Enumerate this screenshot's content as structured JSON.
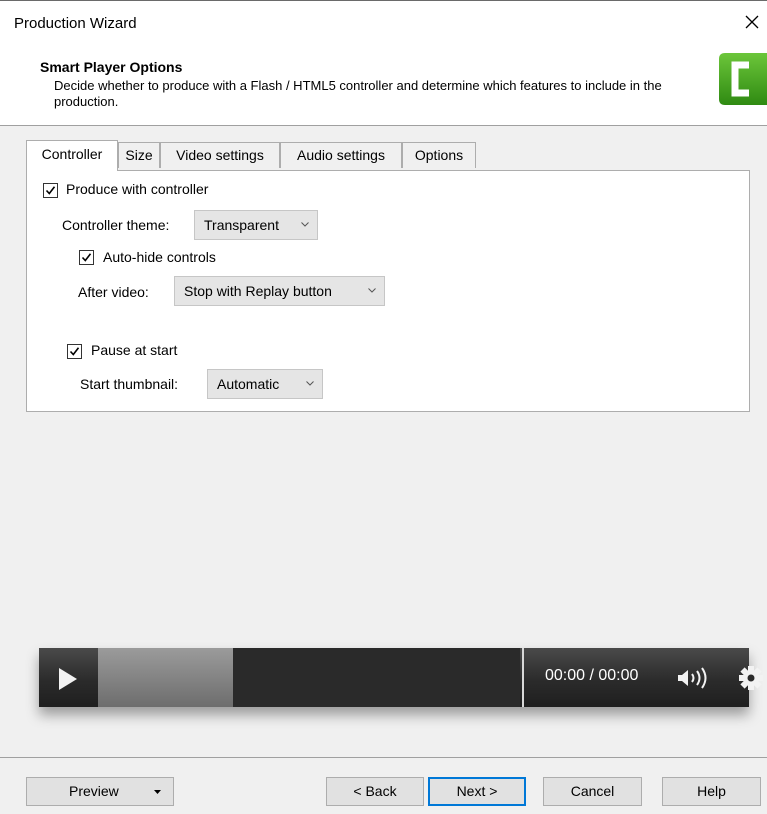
{
  "window": {
    "title": "Production Wizard",
    "close_icon": "close-icon"
  },
  "header": {
    "title": "Smart Player Options",
    "description": "Decide whether to produce with a Flash / HTML5 controller and determine which features to include in the production.",
    "logo_icon": "camtasia-logo",
    "logo_color": "#3a9a18"
  },
  "tabs": [
    {
      "label": "Controller",
      "active": true
    },
    {
      "label": "Size",
      "active": false
    },
    {
      "label": "Video settings",
      "active": false
    },
    {
      "label": "Audio settings",
      "active": false
    },
    {
      "label": "Options",
      "active": false
    }
  ],
  "controller": {
    "produce_with_controller": {
      "label": "Produce with controller",
      "checked": true
    },
    "theme": {
      "label": "Controller theme:",
      "value": "Transparent"
    },
    "auto_hide": {
      "label": "Auto-hide controls",
      "checked": true
    },
    "after_video": {
      "label": "After video:",
      "value": "Stop with Replay button"
    },
    "pause_at_start": {
      "label": "Pause at start",
      "checked": true
    },
    "start_thumbnail": {
      "label": "Start thumbnail:",
      "value": "Automatic"
    }
  },
  "player_preview": {
    "time": "00:00 / 00:00",
    "progress_fraction": 0.32,
    "icons": [
      "play-icon",
      "volume-icon",
      "gear-icon"
    ]
  },
  "footer": {
    "preview_label": "Preview",
    "back_label": "< Back",
    "next_label": "Next >",
    "cancel_label": "Cancel",
    "help_label": "Help"
  }
}
